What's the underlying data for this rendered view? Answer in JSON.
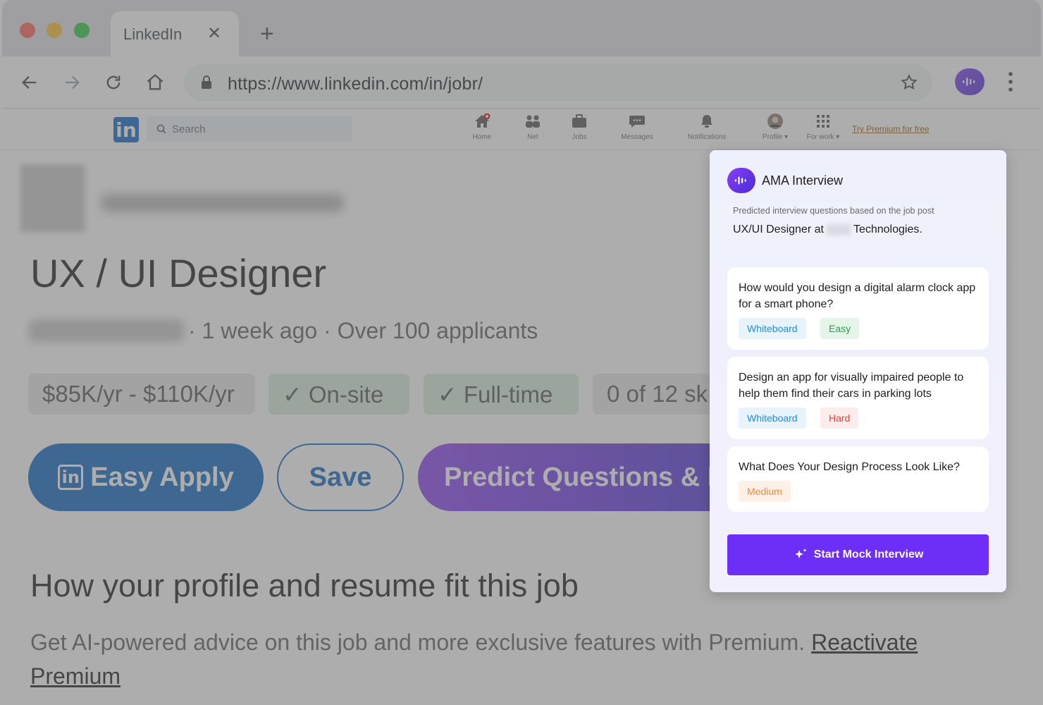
{
  "browser": {
    "tab_title": "LinkedIn",
    "url": "https://www.linkedin.com/in/jobr/",
    "traffic_light_colors": [
      "#ff5f57",
      "#febc2e",
      "#28c840"
    ]
  },
  "linkedin_nav": {
    "logo": "in",
    "search_placeholder": "Search",
    "items": [
      {
        "label": "Home",
        "icon": "home-icon"
      },
      {
        "label": "Net",
        "icon": "network-icon"
      },
      {
        "label": "Jobs",
        "icon": "briefcase-icon"
      },
      {
        "label": "Messages",
        "icon": "message-icon"
      },
      {
        "label": "Notifications",
        "icon": "bell-icon"
      },
      {
        "label": "Profile ▾",
        "icon": "avatar-icon"
      },
      {
        "label": "For work ▾",
        "icon": "grid-icon"
      }
    ],
    "premium_link": "Try Premium for free"
  },
  "job": {
    "title": "UX / UI Designer",
    "meta": "· 1 week ago · Over 100 applicants",
    "chips": [
      "$85K/yr - $110K/yr",
      "✓ On-site",
      "✓ Full-time",
      "0 of 12 sk"
    ],
    "apply_label": "Easy Apply",
    "apply_icon": "in",
    "save_label": "Save",
    "predict_label": "Predict Questions & M",
    "fit_title": "How your profile and resume fit this job",
    "fit_text": "Get AI-powered advice on this job and more exclusive features with Premium.",
    "fit_link": "Reactivate Premium"
  },
  "ama_panel": {
    "title": "AMA Interview",
    "subtitle": "Predicted interview questions based on the job post",
    "job_prefix": "UX/UI Designer at",
    "job_suffix": "Technologies.",
    "questions": [
      {
        "text": "How would you design a digital alarm clock app for a smart phone?",
        "tags": [
          "Whiteboard",
          "Easy"
        ]
      },
      {
        "text": "Design an app for visually impaired people to help them find their cars in parking lots",
        "tags": [
          "Whiteboard",
          "Hard"
        ]
      },
      {
        "text": "What Does Your Design Process Look Like?",
        "tags": [
          "Medium"
        ]
      }
    ],
    "start_label": "Start Mock Interview",
    "accent_color": "#6d2ff7"
  }
}
